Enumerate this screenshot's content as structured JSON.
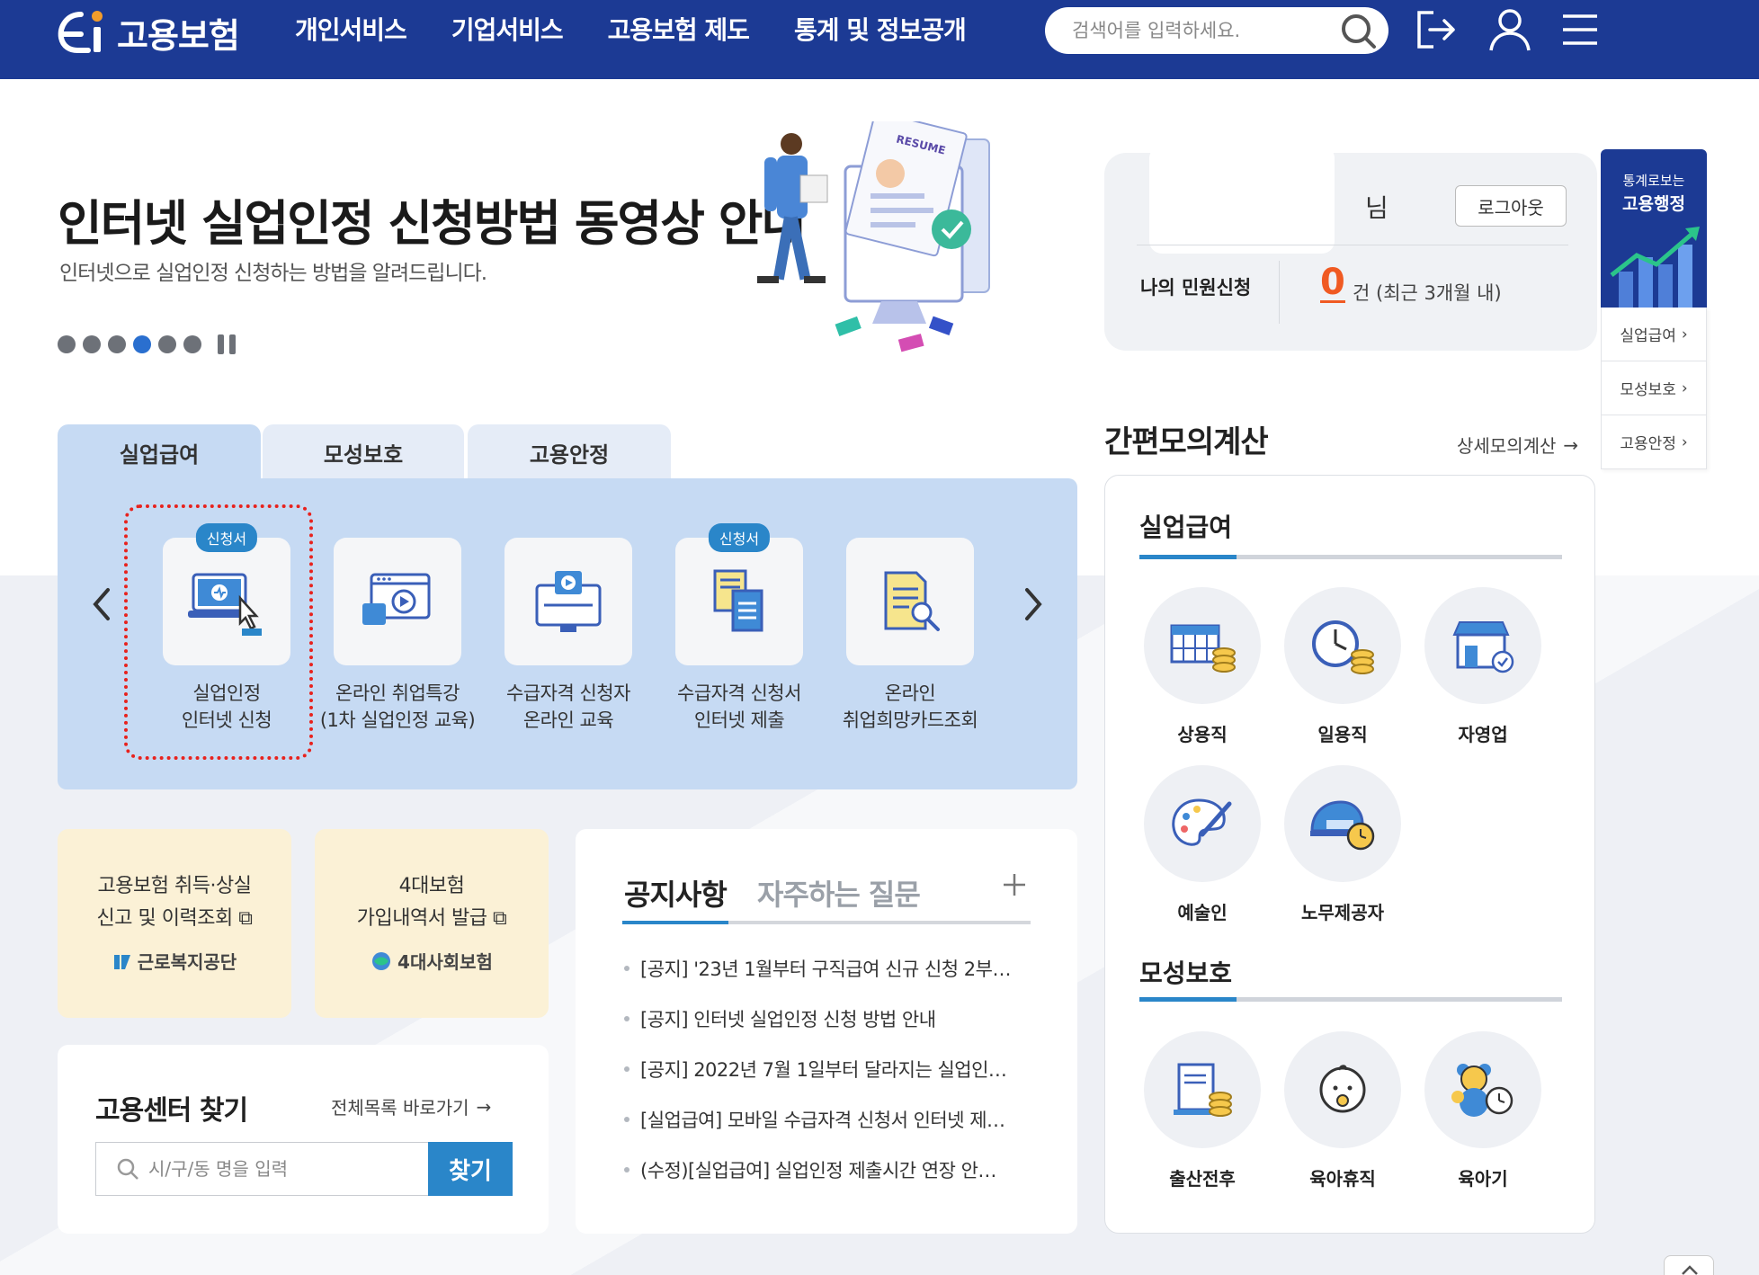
{
  "header": {
    "logo_text": "고용보험",
    "nav": [
      "개인서비스",
      "기업서비스",
      "고용보험 제도",
      "통계 및 정보공개"
    ],
    "search_placeholder": "검색어를 입력하세요.",
    "brand_color": "#1c3a94",
    "icons": [
      "search-icon",
      "logout-icon",
      "user-icon",
      "menu-icon"
    ]
  },
  "banner": {
    "title": "인터넷 실업인정 신청방법 동영상 안내",
    "subtitle": "인터넷으로 실업인정 신청하는 방법을 알려드립니다.",
    "slide_count": 6,
    "active_slide": 4,
    "illustration_text": "RESUME"
  },
  "user": {
    "name_suffix": "님",
    "logout_label": "로그아웃",
    "my_requests_label": "나의 민원신청",
    "count": "0",
    "count_unit": "건 (최근 3개월 내)"
  },
  "side_menu": {
    "top_line1": "통계로보는",
    "top_line2": "고용행정",
    "links": [
      "실업급여",
      "모성보호",
      "고용안정"
    ]
  },
  "tabs": [
    "실업급여",
    "모성보호",
    "고용안정"
  ],
  "services": [
    {
      "label": "실업인정\n인터넷 신청",
      "badge": "신청서"
    },
    {
      "label": "온라인 취업특강\n(1차 실업인정 교육)",
      "badge": ""
    },
    {
      "label": "수급자격 신청자\n온라인 교육",
      "badge": ""
    },
    {
      "label": "수급자격 신청서\n인터넷 제출",
      "badge": "신청서"
    },
    {
      "label": "온라인\n취업희망카드조회",
      "badge": ""
    }
  ],
  "quick_cards": [
    {
      "text": "고용보험 취득·상실\n신고 및 이력조회",
      "org": "근로복지공단"
    },
    {
      "text": "4대보험\n가입내역서 발급",
      "org": "4대사회보험"
    }
  ],
  "center_finder": {
    "title": "고용센터 찾기",
    "all_link": "전체목록 바로가기",
    "placeholder": "시/구/동 명을 입력",
    "button": "찾기"
  },
  "notice": {
    "tab_notice": "공지사항",
    "tab_faq": "자주하는 질문",
    "items": [
      "[공지] '23년 1월부터 구직급여 신규 신청 2부…",
      "[공지] 인터넷 실업인정 신청 방법 안내",
      "[공지] 2022년 7월 1일부터 달라지는 실업인…",
      "[실업급여] 모바일 수급자격 신청서 인터넷 제…",
      "(수정)[실업급여] 실업인정 제출시간 연장 안…"
    ]
  },
  "calculator": {
    "title": "간편모의계산",
    "detail_link": "상세모의계산",
    "section1": "실업급여",
    "section1_items": [
      "상용직",
      "일용직",
      "자영업",
      "예술인",
      "노무제공자"
    ],
    "section2": "모성보호",
    "section2_items": [
      "출산전후",
      "육아휴직",
      "육아기"
    ]
  }
}
